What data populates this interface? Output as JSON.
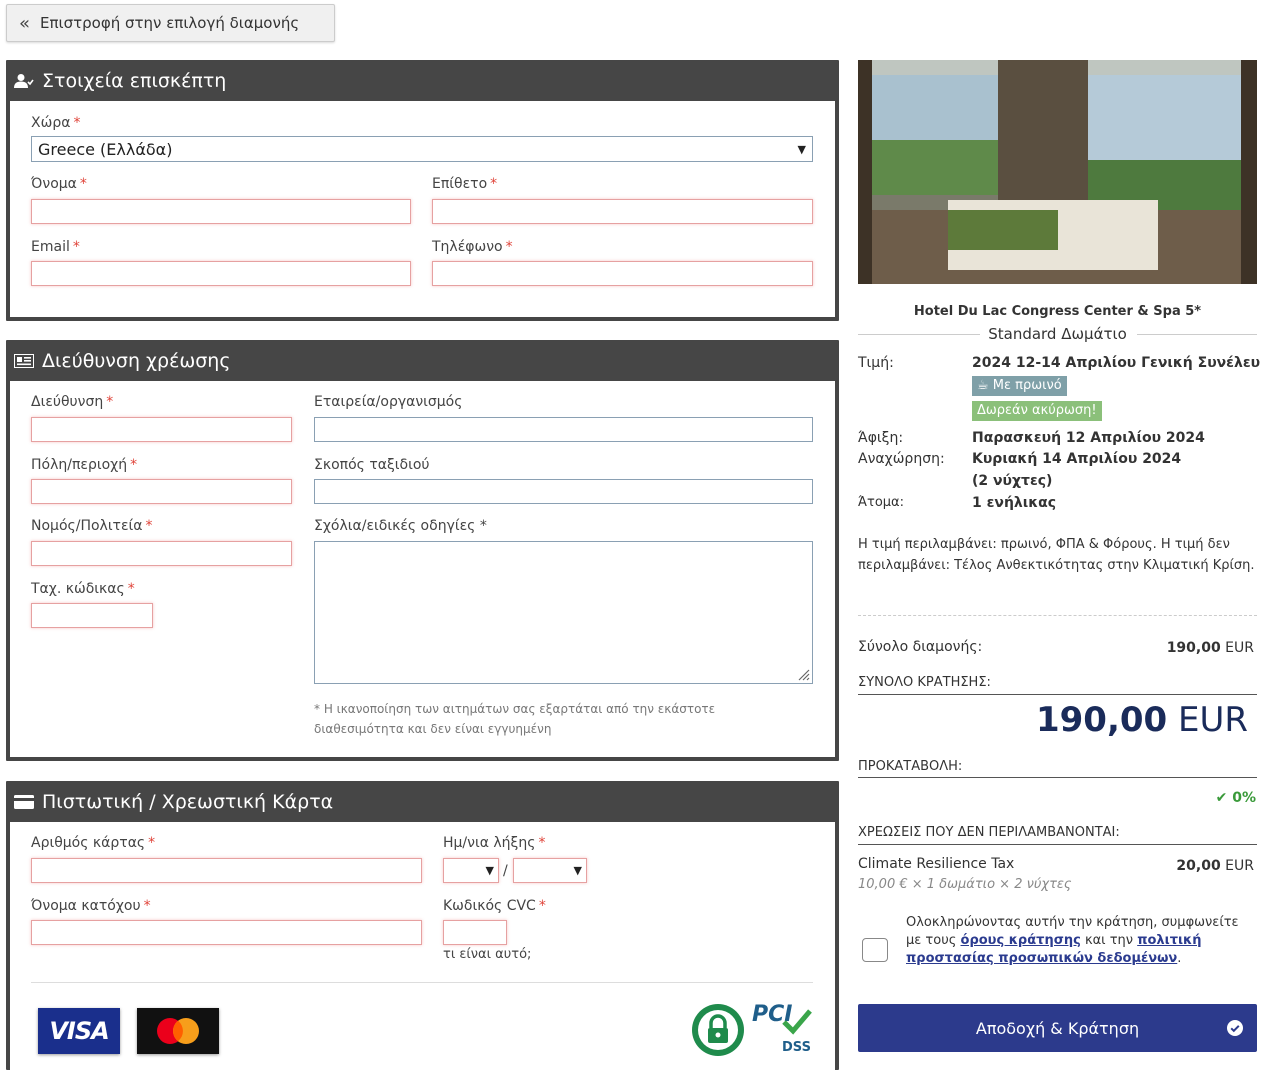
{
  "back": {
    "label": "Επιστροφή στην επιλογή διαμονής"
  },
  "guest": {
    "title": "Στοιχεία επισκέπτη",
    "country_label": "Χώρα",
    "country_value": "Greece (Ελλάδα)",
    "firstname_label": "Όνομα",
    "lastname_label": "Επίθετο",
    "email_label": "Email",
    "phone_label": "Τηλέφωνο"
  },
  "billing": {
    "title": "Διεύθυνση χρέωσης",
    "address_label": "Διεύθυνση",
    "company_label": "Εταιρεία/οργανισμός",
    "city_label": "Πόλη/περιοχή",
    "purpose_label": "Σκοπός ταξιδιού",
    "state_label": "Νομός/Πολιτεία",
    "comments_label": "Σχόλια/ειδικές οδηγίες",
    "comments_mark": "*",
    "zip_label": "Ταχ. κώδικας",
    "note": "* Η ικανοποίηση των αιτημάτων σας εξαρτάται από την εκάστοτε διαθεσιμότητα και δεν είναι εγγυημένη"
  },
  "card": {
    "title": "Πιστωτική / Χρεωστική Κάρτα",
    "number_label": "Αριθμός κάρτας",
    "expiry_label": "Ημ/νια λήξης",
    "expiry_sep": "/",
    "holder_label": "Όνομα κατόχου",
    "cvc_label": "Κωδικός CVC",
    "cvc_help": "τι είναι αυτό;",
    "visa": "VISA",
    "pci": "PCI",
    "dss": "DSS"
  },
  "summary": {
    "hotel": "Hotel Du Lac Congress Center & Spa 5*",
    "room": "Standard Δωμάτιο",
    "price_label": "Τιμή:",
    "price_value": "2024 12-14 Απριλίου Γενική Συνέλευ",
    "badge_breakfast": "Με πρωινό",
    "badge_cancel": "Δωρεάν ακύρωση!",
    "arrival_label": "Άφιξη:",
    "arrival_value": "Παρασκευή 12 Απριλίου 2024",
    "departure_label": "Αναχώρηση:",
    "departure_value": "Κυριακή 14 Απριλίου 2024",
    "nights": "(2 νύχτες)",
    "persons_label": "Άτομα:",
    "persons_value": "1 ενήλικας",
    "includes": "Η τιμή περιλαμβάνει: πρωινό, ΦΠΑ & Φόρους. Η τιμή δεν περιλαμβάνει: Τέλος Ανθεκτικότητας στην Κλιματική Κρίση.",
    "stay_total_label": "Σύνολο διαμονής:",
    "stay_total_amount": "190,00",
    "currency": "EUR",
    "booking_total_label": "ΣΥΝΟΛΟ ΚΡΑΤΗΣΗΣ:",
    "booking_total_amount": "190,00",
    "deposit_label": "ΠΡΟΚΑΤΑΒΟΛΗ:",
    "deposit_value": "0%",
    "extra_label": "ΧΡΕΩΣΕΙΣ ΠΟΥ ΔΕΝ ΠΕΡΙΛΑΜΒΑΝΟΝΤΑΙ:",
    "tax_name": "Climate Resilience Tax",
    "tax_amount": "20,00",
    "tax_detail": "10,00 € × 1 δωμάτιο × 2 νύχτες",
    "terms_pre": "Ολοκληρώνοντας αυτήν την κράτηση, συμφωνείτε με τους",
    "terms_link": "όρους κράτησης",
    "terms_mid": "και την",
    "privacy_link": "πολιτική προστασίας προσωπικών δεδομένων",
    "terms_end": ".",
    "accept": "Αποδοχή & Κράτηση"
  }
}
